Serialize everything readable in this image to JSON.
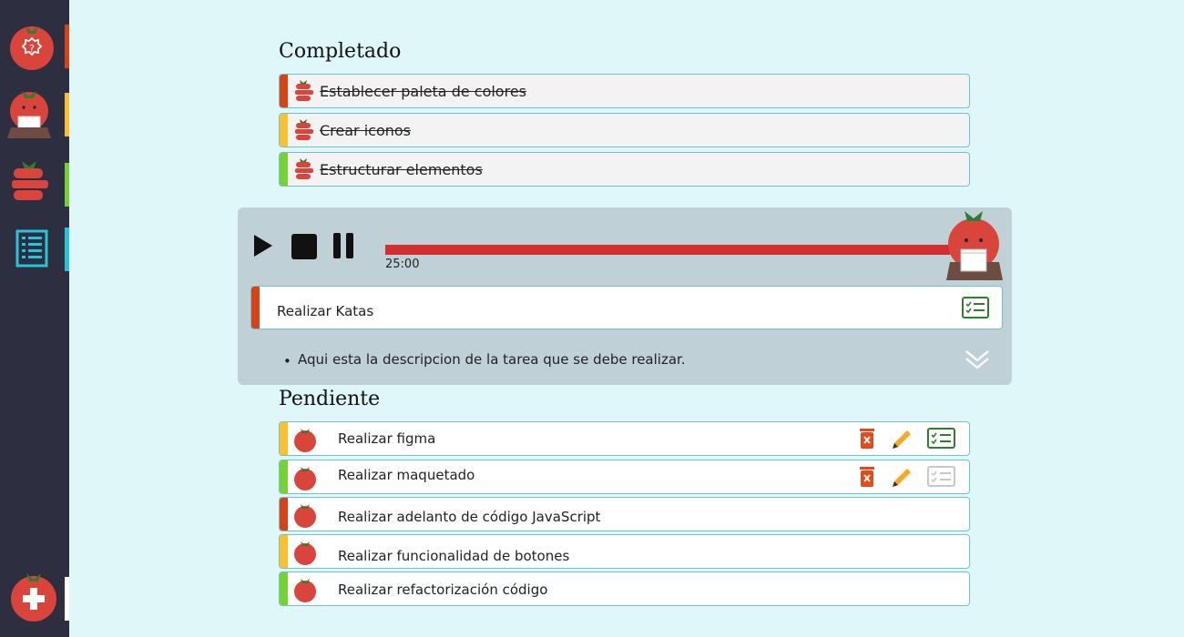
{
  "colors": {
    "background": "#e0f7fa",
    "sidebar": "#2d2e40",
    "tomato": "#d9453a",
    "accent_red": "#d84315",
    "accent_yellow": "#fbc02d",
    "accent_green": "#76d22f",
    "accent_cyan": "#26c6da",
    "progress": "#d32f2f",
    "panel": "#bfd1d6"
  },
  "sidebar": {
    "items": [
      {
        "icon": "help-tomato-icon",
        "accent": "#d84315"
      },
      {
        "icon": "tomato-mascot-icon",
        "accent": "#fbc02d"
      },
      {
        "icon": "tomato-stack-icon",
        "accent": "#76d22f"
      },
      {
        "icon": "task-list-icon",
        "accent": "#26c6da"
      },
      {
        "icon": "add-tomato-icon",
        "accent": "#ffffff"
      }
    ]
  },
  "completed": {
    "title": "Completado",
    "tasks": [
      {
        "label": "Establecer paleta de colores",
        "accent": "#d84315"
      },
      {
        "label": "Crear iconos",
        "accent": "#fbc02d"
      },
      {
        "label": "Estructurar elementos",
        "accent": "#76d22f"
      }
    ]
  },
  "timer": {
    "time": "25:00",
    "progress": 1.0,
    "current_task": "Realizar Katas",
    "description": "Aqui esta la descripcion de la tarea que se debe realizar."
  },
  "pending": {
    "title": "Pendiente",
    "tasks": [
      {
        "label": "Realizar figma",
        "accent": "#fbc02d"
      },
      {
        "label": "Realizar maquetado",
        "accent": "#76d22f"
      },
      {
        "label": "Realizar adelanto de código  JavaScript",
        "accent": "#d84315"
      },
      {
        "label": "Realizar funcionalidad de botones",
        "accent": "#fbc02d"
      },
      {
        "label": "Realizar refactorización código",
        "accent": "#76d22f"
      }
    ]
  }
}
